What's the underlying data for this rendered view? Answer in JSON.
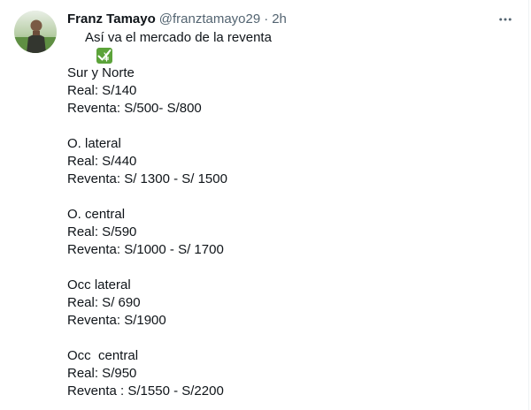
{
  "author": {
    "name": "Franz Tamayo",
    "handle": "@franztamayo29",
    "separator": "·",
    "time": "2h"
  },
  "tweet": {
    "intro_text": "Así va el mercado de la reventa",
    "intro_emoji": "check-mark-yen-emoji",
    "sections": [
      {
        "zone": "Sur y Norte",
        "real": "Real: S/140",
        "reventa": "Reventa: S/500- S/800"
      },
      {
        "zone": "O. lateral",
        "real": "Real: S/440",
        "reventa": "Reventa: S/ 1300 - S/ 1500"
      },
      {
        "zone": "O. central",
        "real": "Real: S/590",
        "reventa": "Reventa: S/1000 - S/ 1700"
      },
      {
        "zone": "Occ lateral",
        "real": "Real: S/ 690",
        "reventa": "Reventa: S/1900"
      },
      {
        "zone": "Occ  central",
        "real": "Real: S/950",
        "reventa": "Reventa : S/1550 - S/2200"
      }
    ]
  },
  "icons": {
    "more": "more-horizontal-icon"
  },
  "colors": {
    "text_primary": "#0f1419",
    "text_secondary": "#536471",
    "emoji_green": "#5ca33a"
  }
}
